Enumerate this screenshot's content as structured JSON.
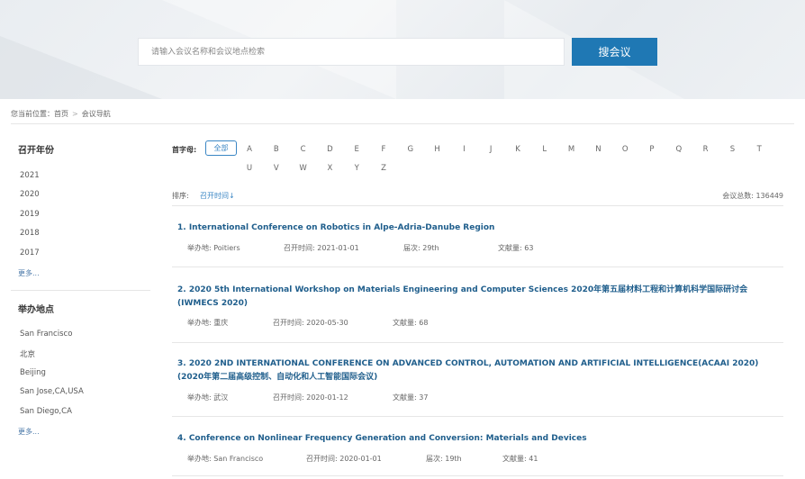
{
  "search": {
    "placeholder": "请输入会议名称和会议地点检索",
    "button_label": "搜会议"
  },
  "breadcrumb": {
    "prefix": "您当前位置：",
    "home": "首页",
    "separator": ">",
    "current": "会议导航"
  },
  "sidebar": {
    "year_title": "召开年份",
    "years": [
      "2021",
      "2020",
      "2019",
      "2018",
      "2017"
    ],
    "year_more": "更多...",
    "location_title": "举办地点",
    "locations": [
      "San Francisco",
      "北京",
      "Beijing",
      "San Jose,CA,USA",
      "San Diego,CA"
    ],
    "location_more": "更多..."
  },
  "filter": {
    "label": "首字母:",
    "all_label": "全部",
    "letters": [
      "A",
      "B",
      "C",
      "D",
      "E",
      "F",
      "G",
      "H",
      "I",
      "J",
      "K",
      "L",
      "M",
      "N",
      "O",
      "P",
      "Q",
      "R",
      "S",
      "T",
      "U",
      "V",
      "W",
      "X",
      "Y",
      "Z"
    ]
  },
  "sort": {
    "label": "排序:",
    "option": "召开时间↓"
  },
  "total": {
    "label": "会议总数:",
    "value": "136449"
  },
  "results": [
    {
      "title": "1. International Conference on Robotics in Alpe-Adria-Danube Region",
      "location": "举办地: Poitiers",
      "date": "召开时间: 2021-01-01",
      "session": "届次: 29th",
      "count": "文献量: 63"
    },
    {
      "title": "2. 2020 5th International Workshop on Materials Engineering and Computer Sciences 2020年第五届材料工程和计算机科学国际研讨会(IWMECS 2020)",
      "location": "举办地: 重庆",
      "date": "召开时间: 2020-05-30",
      "session": "",
      "count": "文献量: 68"
    },
    {
      "title": "3. 2020 2ND INTERNATIONAL CONFERENCE ON ADVANCED CONTROL, AUTOMATION AND ARTIFICIAL INTELLIGENCE(ACAAI 2020)(2020年第二届高级控制、自动化和人工智能国际会议)",
      "location": "举办地: 武汉",
      "date": "召开时间: 2020-01-12",
      "session": "",
      "count": "文献量: 37"
    },
    {
      "title": "4. Conference on Nonlinear Frequency Generation and Conversion: Materials and Devices",
      "location": "举办地: San Francisco",
      "date": "召开时间: 2020-01-01",
      "session": "届次: 19th",
      "count": "文献量: 41"
    }
  ],
  "colors": {
    "accent": "#1f78b4",
    "title_link": "#1f5e8c"
  }
}
